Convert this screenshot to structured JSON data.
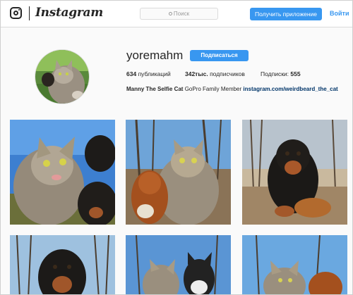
{
  "header": {
    "wordmark": "Instagram",
    "search_placeholder": "Поиск",
    "get_app_label": "Получить приложение",
    "login_label": "Войти"
  },
  "profile": {
    "username": "yoremahm",
    "subscribe_label": "Подписаться",
    "posts_count": "634",
    "posts_label": "публикаций",
    "followers_count": "342тыс.",
    "followers_label": "подписчиков",
    "following_label": "Подписки:",
    "following_count": "555",
    "full_name": "Manny The Selfie Cat",
    "bio_text": "GoPro Family Member",
    "bio_link": "instagram.com/weirdbeard_the_cat"
  },
  "colors": {
    "accent": "#3897f0",
    "link": "#003569",
    "text": "#262626"
  },
  "icons": [
    "instagram-glyph-icon",
    "search-icon"
  ],
  "posts": [
    {
      "id": "post-1",
      "subject": "cat-and-rottweiler-selfie"
    },
    {
      "id": "post-2",
      "subject": "cat-and-spaniel-selfie-in-woods"
    },
    {
      "id": "post-3",
      "subject": "rottweiler-in-autumn-woods"
    },
    {
      "id": "post-4",
      "subject": "rottweiler-under-trees"
    },
    {
      "id": "post-5",
      "subject": "two-cats-in-woods"
    },
    {
      "id": "post-6",
      "subject": "cat-and-spaniel-in-field"
    }
  ]
}
